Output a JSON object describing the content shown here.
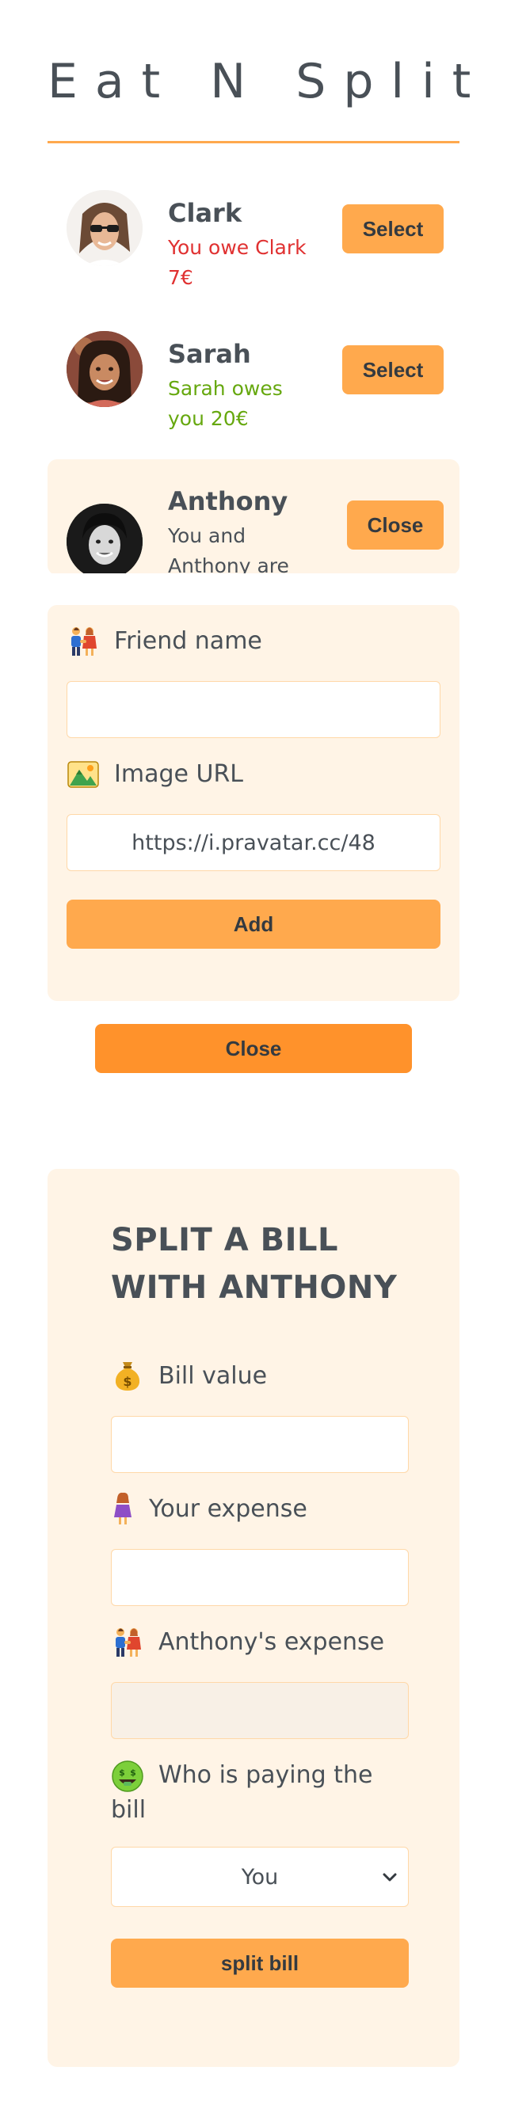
{
  "app": {
    "title": "Eat N Split"
  },
  "friends": [
    {
      "name": "Clark",
      "status": "You owe Clark 7€",
      "status_kind": "owe",
      "button": "Select"
    },
    {
      "name": "Sarah",
      "status": "Sarah owes you 20€",
      "status_kind": "owed",
      "button": "Select"
    },
    {
      "name": "Anthony",
      "status": "You and Anthony are even",
      "status_kind": "even",
      "button": "Close"
    }
  ],
  "add_friend_form": {
    "name_label": "Friend name",
    "name_icon": "couple-icon",
    "name_value": "",
    "image_label": "Image URL",
    "image_icon": "landscape-icon",
    "image_value": "https://i.pravatar.cc/48",
    "submit_label": "Add"
  },
  "close_button_label": "Close",
  "split_form": {
    "title": "SPLIT A BILL WITH ANTHONY",
    "bill_label": "Bill value",
    "bill_icon": "money-bag-icon",
    "bill_value": "",
    "your_expense_label": "Your expense",
    "your_expense_icon": "woman-icon",
    "your_expense_value": "",
    "friend_expense_label": "Anthony's expense",
    "friend_expense_icon": "couple-icon",
    "friend_expense_value": "",
    "payer_label": "Who is paying the bill",
    "payer_icon": "money-mouth-face-icon",
    "payer_selected": "You",
    "submit_label": "split bill"
  },
  "colors": {
    "accent": "#ffa94d",
    "accent_dark": "#ff922b",
    "panel": "#fff4e6",
    "text": "#495057",
    "owe": "#e03131",
    "owed": "#66a80f"
  }
}
